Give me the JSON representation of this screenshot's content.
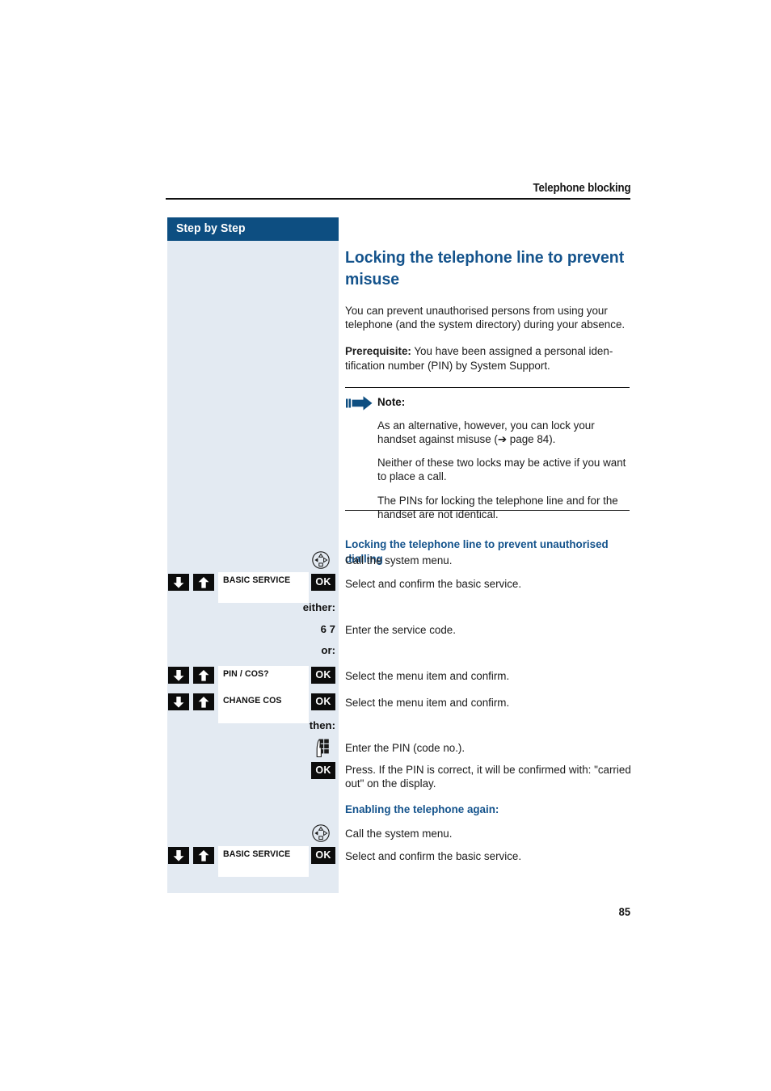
{
  "header": {
    "running_title": "Telephone blocking"
  },
  "sidebar": {
    "title": "Step by Step"
  },
  "page_number": "85",
  "main": {
    "section_title": "Locking the telephone line to prevent misuse",
    "intro_paragraph": "You can prevent unauthorised persons from using your telephone (and the system directory) during your absence.",
    "prerequisite_label": "Prerequisite:",
    "prerequisite_text": " You have been assigned a personal iden­tification number (PIN) by System Support.",
    "note": {
      "icon": "blue-arrow-icon",
      "label": "Note:",
      "paragraphs": [
        "As an alternative, however, you can lock your handset against misuse (➔ page 84).",
        "Neither of these two locks may be active if you want to place a call.",
        "The PINs for locking the telephone line and for the handset are not identical."
      ]
    },
    "sub_head_1": "Locking the telephone line to prevent unauthorised dialling",
    "sub_head_2": "Enabling the telephone again:"
  },
  "steps": [
    {
      "id": "call-system-menu-1",
      "icon": "navigation-rocker-icon",
      "text": "Call the system menu."
    },
    {
      "id": "select-basic-service-1",
      "key_down": "down-arrow-key",
      "key_up": "up-arrow-key",
      "display": "BASIC SERVICE",
      "ok": "OK",
      "text": "Select and confirm the basic service."
    },
    {
      "id": "either",
      "right_label": "either:"
    },
    {
      "id": "service-code",
      "right_label": "6 7",
      "text": "Enter the service code."
    },
    {
      "id": "or",
      "right_label": "or:"
    },
    {
      "id": "select-pin-cos",
      "key_down": "down-arrow-key",
      "key_up": "up-arrow-key",
      "display": "PIN / COS?",
      "ok": "OK",
      "text": "Select the menu item and confirm."
    },
    {
      "id": "select-change-cos",
      "key_down": "down-arrow-key",
      "key_up": "up-arrow-key",
      "display": "CHANGE COS",
      "ok": "OK",
      "text": "Select the menu item and confirm."
    },
    {
      "id": "then",
      "right_label": "then:"
    },
    {
      "id": "enter-pin",
      "icon": "keypad-icon",
      "text": "Enter the PIN (code no.)."
    },
    {
      "id": "press-ok-confirm",
      "ok": "OK",
      "text": "Press. If the PIN is correct, it will be confirmed with: \"carried out\" on the display."
    },
    {
      "id": "call-system-menu-2",
      "icon": "navigation-rocker-icon",
      "text": "Call the system menu."
    },
    {
      "id": "select-basic-service-2",
      "key_down": "down-arrow-key",
      "key_up": "up-arrow-key",
      "display": "BASIC SERVICE",
      "ok": "OK",
      "text": "Select and confirm the basic service."
    }
  ],
  "colors": {
    "brand_blue": "#0d4e81",
    "heading_blue": "#14538c",
    "sidebar_bg": "#e3eaf2",
    "key_black": "#0c0c0c"
  }
}
